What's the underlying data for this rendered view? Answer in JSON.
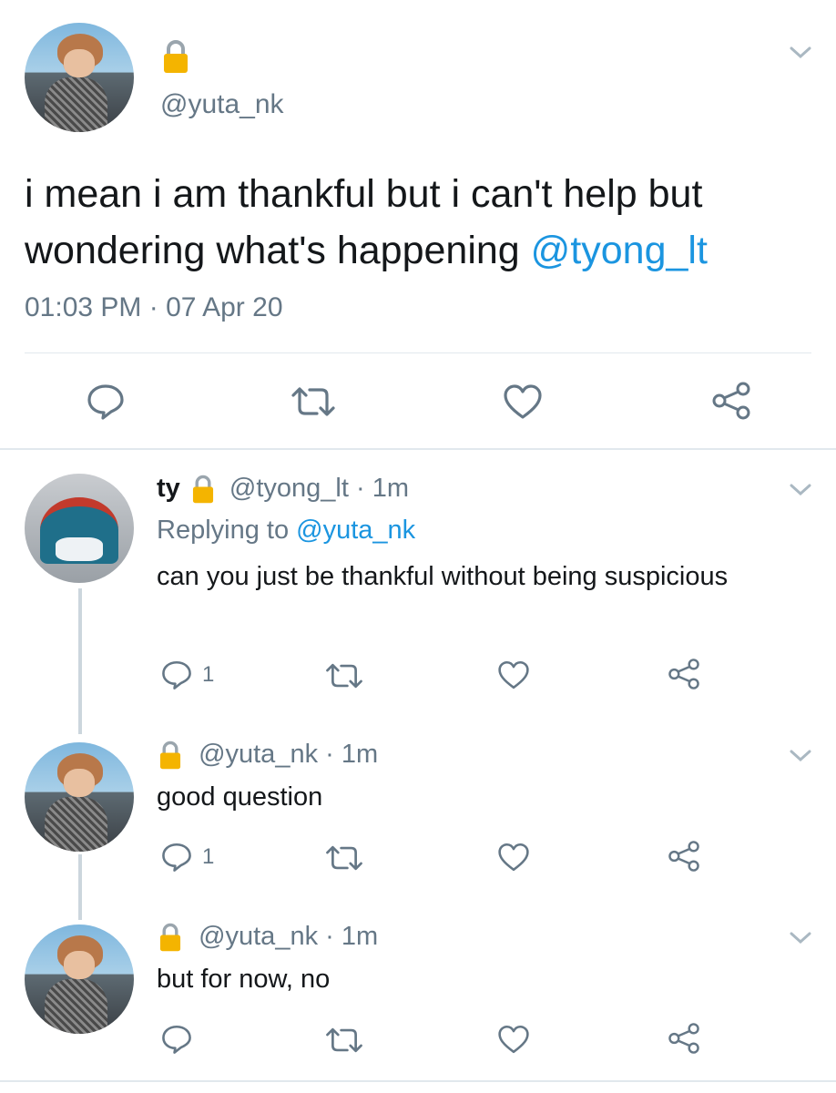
{
  "main_tweet": {
    "handle": "@yuta_nk",
    "text": "i mean i am thankful but i can't help but wondering what's happening",
    "mention": "@tyong_lt",
    "timestamp": "01:03 PM · 07 Apr 20"
  },
  "replies": [
    {
      "display_name": "ty",
      "handle": "@tyong_lt",
      "separator": "·",
      "age": "1m",
      "replying_label": "Replying to",
      "replying_to": "@yuta_nk",
      "text": "can you just be thankful without being suspicious",
      "reply_count": "1"
    },
    {
      "handle": "@yuta_nk",
      "separator": "·",
      "age": "1m",
      "text": "good question",
      "reply_count": "1"
    },
    {
      "handle": "@yuta_nk",
      "separator": "·",
      "age": "1m",
      "text": "but for now, no",
      "reply_count": ""
    }
  ],
  "icons": [
    "lock-icon",
    "chevron-down-icon",
    "reply-icon",
    "retweet-icon",
    "like-icon",
    "share-icon"
  ],
  "colors": {
    "accent": "#1b95e0",
    "muted": "#657786",
    "text": "#14171a",
    "divider": "#e1e8ed",
    "icon": "#657786",
    "lock": "#f4b400"
  }
}
